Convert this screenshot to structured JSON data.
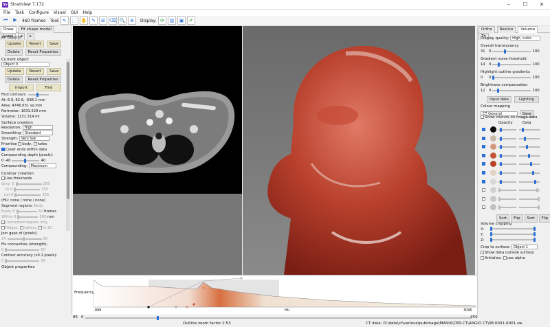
{
  "window": {
    "title": "Stradview 7.172",
    "logo": "Sv",
    "min": "–",
    "max": "☐",
    "close": "✕"
  },
  "menu": [
    "File",
    "Task",
    "Configure",
    "Visual",
    "GUI",
    "Help"
  ],
  "toolbar": {
    "frames": "460 frames",
    "tool_label": "Tool:",
    "display_label": "Display:"
  },
  "left": {
    "tabs": [
      "Draw",
      "Fit shape model",
      "Land"
    ],
    "all_objects": "All objects",
    "update": "Update",
    "revert": "Revert",
    "save": "Save",
    "delete": "Delete",
    "reset": "Reset Properties",
    "current_object": "Current object",
    "object_value": "Object 0",
    "import": "Import",
    "find": "Find",
    "find_contours": "Find contours:",
    "at": "At: 6.9, 82.9, -698.1 mm",
    "area": "Area: 4746.031 sq mm",
    "perimeter": "Perimeter: 1631.529 mm",
    "volume": "Volume: 1131.314 ml",
    "surface_creation": "Surface creation",
    "resolution_label": "Resolution:",
    "resolution": "High",
    "smoothing_label": "Smoothing:",
    "smoothing": "Standard",
    "strength_label": "Strength:",
    "strength": "Very low",
    "prioritise": "Prioritise",
    "body": "body,",
    "holes": "holes",
    "cover_ends": "Cover ends within data",
    "comp_depth": "Compounding depth (pixels):",
    "comp_min": "0",
    "comp_mid": "-40",
    "comp_max": "40",
    "compounding_label": "Compounding:",
    "compounding": "Maximum",
    "contour_creation": "Contour creation",
    "use_thresholds": "Use thresholds",
    "grey": "Grey:",
    "grey_v": "0",
    "grey_max": "255",
    "to": "to",
    "to_v": "0",
    "to_max": "255",
    "not": "not",
    "not_v": "0",
    "not_max": "255",
    "hu": "(HU:  none / none / none)",
    "segment_regions": "Segment regions:",
    "segment_val": "Body",
    "every": "Every",
    "every_v": "0",
    "every_max": "50",
    "frames": "frames",
    "within": "Within",
    "within_v": "0",
    "within_max": "300",
    "mm": "mm",
    "connected": "Connected regions only",
    "ridges": "Ridges,",
    "valleys": "valleys,",
    "in3d": "in 3D",
    "join_gaps": "Join gaps of (pixels):",
    "join_v": "24",
    "join_max": "50",
    "fix_conc": "Fix concavities (strength):",
    "fix_v": "0",
    "fix_max": "50",
    "contour_acc": "Contour accuracy (x0.1 pixels):",
    "acc_v": "0",
    "acc_max": "50",
    "object_props": "Object properties"
  },
  "right": {
    "tabs": [
      "Ortho",
      "Reslice",
      "Volume",
      "Th"
    ],
    "display_quality_label": "Display quality:",
    "display_quality": "High, cubic",
    "overall_translucency": "Overall translucency",
    "ot_v": "31",
    "ot_min": "0",
    "ot_max": "100",
    "gradient_noise": "Gradient noise threshold",
    "gn_v": "14",
    "gn_min": "0",
    "gn_max": "100",
    "highlight": "Highlight outline gradients",
    "hl_v": "0",
    "hl_min": "0",
    "hl_max": "100",
    "brightness": "Brightness compensation",
    "br_v": "12",
    "br_min": "0",
    "br_max": "100",
    "input_data": "Input data",
    "lighting": "Lighting",
    "colour_mapping": "Colour mapping",
    "cmap": "CT General",
    "cm_save": "Save",
    "show_colours": "Show colours on image data",
    "opacity": "Opacity",
    "data": "Data",
    "swatches": [
      "#0a0a0a",
      "#c8b8a8",
      "#d49a80",
      "#c2553a",
      "#b8442a",
      "#e4d2c2",
      "#d8d8d8",
      "#d0d0d0",
      "#c8c8c8",
      "#c0c0c0"
    ],
    "sort": "Sort",
    "flip": "Flip",
    "volume_cropping": "Volume cropping",
    "x": "X:",
    "y": "Y:",
    "z": "Z:",
    "crop_label": "Crop to surface:",
    "crop": "Object 1",
    "show_outside": "Show data outside surface",
    "antialias": "Antialias,",
    "use_alpha": "use alpha"
  },
  "hist": {
    "label": "Frequency",
    "x_min": "-999",
    "x_mid": "HU",
    "x_max": "3095"
  },
  "status": {
    "left": "85",
    "v0": "0",
    "outline": "Outline zoom factor 2.53",
    "right": "459",
    "ct": "CT data: D:\\data\\ct\\various\\pubimage\\MANIX\\CER-CT\\ANGIO CT\\IM-0001-0001.sw"
  }
}
